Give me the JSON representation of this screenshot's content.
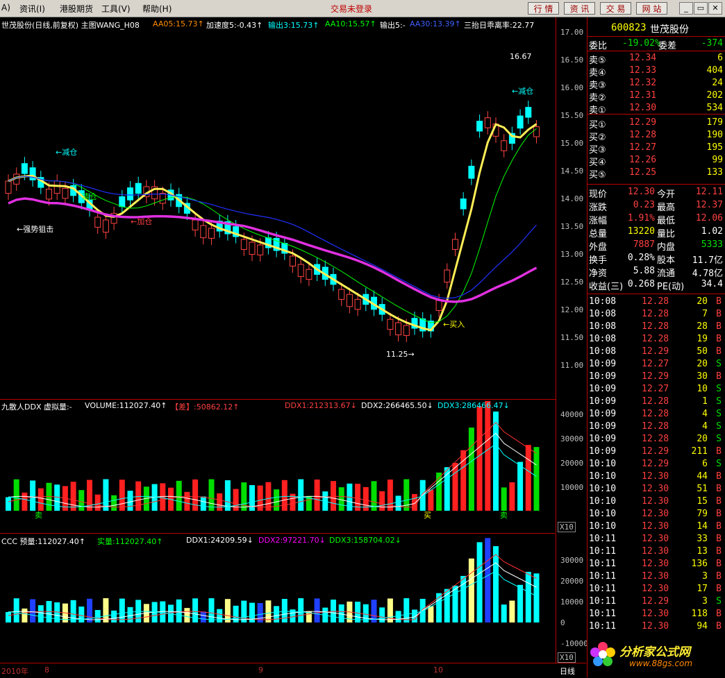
{
  "menu": {
    "items": [
      "A)",
      "资讯(I)",
      "港股期货",
      "工具(V)",
      "帮助(H)"
    ],
    "login_status": "交易未登录",
    "buttons": [
      "行 情",
      "资 讯",
      "交 易",
      "网 站"
    ],
    "win_buttons": [
      "_",
      "▭",
      "✕"
    ]
  },
  "main_chart": {
    "header": {
      "title": "世茂股份(日线,前复权) 主图WANG_H08",
      "aa05": "AA05:15.73↑",
      "accel": "加速度5:-0.43↑",
      "out3": "输出3:15.73↑",
      "aa10": "AA10:15.57↑",
      "out5": "输出5:-",
      "aa30": "AA30:13.39↑",
      "deviation": "三抬日乖离率:22.77"
    },
    "axis_ticks": [
      "17.00",
      "16.50",
      "16.00",
      "15.50",
      "15.00",
      "14.50",
      "14.00",
      "13.50",
      "13.00",
      "12.50",
      "12.00",
      "11.50",
      "11.00"
    ],
    "annotations": {
      "reduce1": "←减仓",
      "reduce2": "←减仓",
      "clear": "清仓",
      "add": "←加仓",
      "block": "←强势狙击",
      "buy": "←买入",
      "low": "11.25→",
      "high": "16.67"
    }
  },
  "ddx_chart": {
    "header": {
      "name": "九散人DDX 虚拟量:-",
      "volume": "VOLUME:112027.40↑",
      "diff": "【差】:50862.12↑",
      "ddx1": "DDX1:212313.67↓",
      "ddx2": "DDX2:266465.50↓",
      "ddx3": "DDX3:286466.47↓"
    },
    "axis_ticks": [
      "40000",
      "30000",
      "20000",
      "10000"
    ],
    "unit": "X10",
    "marks": {
      "sell1": "卖",
      "buy": "买",
      "sell2": "卖"
    }
  },
  "ccc_chart": {
    "header": {
      "name": "CCC 预量:112027.40↑",
      "real": "实量:112027.40↑",
      "ddx1": "DDX1:24209.59↓",
      "ddx2": "DDX2:97221.70↓",
      "ddx3": "DDX3:158704.02↓"
    },
    "axis_ticks": [
      "30000",
      "20000",
      "10000",
      "0",
      "-10000"
    ],
    "unit": "X10"
  },
  "footer": {
    "dates": [
      "2010年",
      "8",
      "9",
      "10"
    ],
    "period": "日线"
  },
  "panel": {
    "code": "600823",
    "name": "世茂股份",
    "ratio": {
      "label": "委比",
      "value": "-19.02%",
      "diff_label": "委差",
      "diff": "-374"
    },
    "asks": [
      {
        "label": "卖⑤",
        "price": "12.34",
        "vol": "6"
      },
      {
        "label": "卖④",
        "price": "12.33",
        "vol": "404"
      },
      {
        "label": "卖③",
        "price": "12.32",
        "vol": "24"
      },
      {
        "label": "卖②",
        "price": "12.31",
        "vol": "202"
      },
      {
        "label": "卖①",
        "price": "12.30",
        "vol": "534"
      }
    ],
    "bids": [
      {
        "label": "买①",
        "price": "12.29",
        "vol": "179"
      },
      {
        "label": "买②",
        "price": "12.28",
        "vol": "190"
      },
      {
        "label": "买③",
        "price": "12.27",
        "vol": "195"
      },
      {
        "label": "买④",
        "price": "12.26",
        "vol": "99"
      },
      {
        "label": "买⑤",
        "price": "12.25",
        "vol": "133"
      }
    ],
    "stats": [
      {
        "l1": "现价",
        "v1": "12.30",
        "c1": "red",
        "l2": "今开",
        "v2": "12.11",
        "c2": "red"
      },
      {
        "l1": "涨跌",
        "v1": "0.23",
        "c1": "red",
        "l2": "最高",
        "v2": "12.37",
        "c2": "red"
      },
      {
        "l1": "涨幅",
        "v1": "1.91%",
        "c1": "red",
        "l2": "最低",
        "v2": "12.06",
        "c2": "red"
      },
      {
        "l1": "总量",
        "v1": "13220",
        "c1": "yellow",
        "l2": "量比",
        "v2": "1.02",
        "c2": "white"
      },
      {
        "l1": "外盘",
        "v1": "7887",
        "c1": "red",
        "l2": "内盘",
        "v2": "5333",
        "c2": "green"
      },
      {
        "l1": "换手",
        "v1": "0.28%",
        "c1": "white",
        "l2": "股本",
        "v2": "11.7亿",
        "c2": "white"
      },
      {
        "l1": "净资",
        "v1": "5.88",
        "c1": "white",
        "l2": "流通",
        "v2": "4.78亿",
        "c2": "white"
      },
      {
        "l1": "收益(三)",
        "v1": "0.268",
        "c1": "white",
        "l2": "PE(动)",
        "v2": "34.4",
        "c2": "white"
      }
    ],
    "ticks": [
      [
        "10:08",
        "12.28",
        "20",
        "B"
      ],
      [
        "10:08",
        "12.28",
        "7",
        "B"
      ],
      [
        "10:08",
        "12.28",
        "28",
        "B"
      ],
      [
        "10:08",
        "12.28",
        "19",
        "B"
      ],
      [
        "10:08",
        "12.29",
        "50",
        "B"
      ],
      [
        "10:09",
        "12.27",
        "20",
        "S"
      ],
      [
        "10:09",
        "12.29",
        "30",
        "B"
      ],
      [
        "10:09",
        "12.27",
        "10",
        "S"
      ],
      [
        "10:09",
        "12.28",
        "1",
        "S"
      ],
      [
        "10:09",
        "12.28",
        "4",
        "S"
      ],
      [
        "10:09",
        "12.28",
        "4",
        "S"
      ],
      [
        "10:09",
        "12.28",
        "20",
        "S"
      ],
      [
        "10:09",
        "12.29",
        "211",
        "B"
      ],
      [
        "10:10",
        "12.29",
        "6",
        "S"
      ],
      [
        "10:10",
        "12.30",
        "44",
        "B"
      ],
      [
        "10:10",
        "12.30",
        "51",
        "B"
      ],
      [
        "10:10",
        "12.30",
        "15",
        "B"
      ],
      [
        "10:10",
        "12.30",
        "79",
        "B"
      ],
      [
        "10:10",
        "12.30",
        "14",
        "B"
      ],
      [
        "10:11",
        "12.30",
        "33",
        "B"
      ],
      [
        "10:11",
        "12.30",
        "13",
        "B"
      ],
      [
        "10:11",
        "12.30",
        "136",
        "B"
      ],
      [
        "10:11",
        "12.30",
        "3",
        "B"
      ],
      [
        "10:11",
        "12.30",
        "17",
        "B"
      ],
      [
        "10:11",
        "12.29",
        "3",
        "S"
      ],
      [
        "10:11",
        "12.30",
        "118",
        "B"
      ],
      [
        "10:11",
        "12.30",
        "94",
        "B"
      ]
    ],
    "watermark": "分析家公式网",
    "watermark_url": "www.88gs.com"
  }
}
